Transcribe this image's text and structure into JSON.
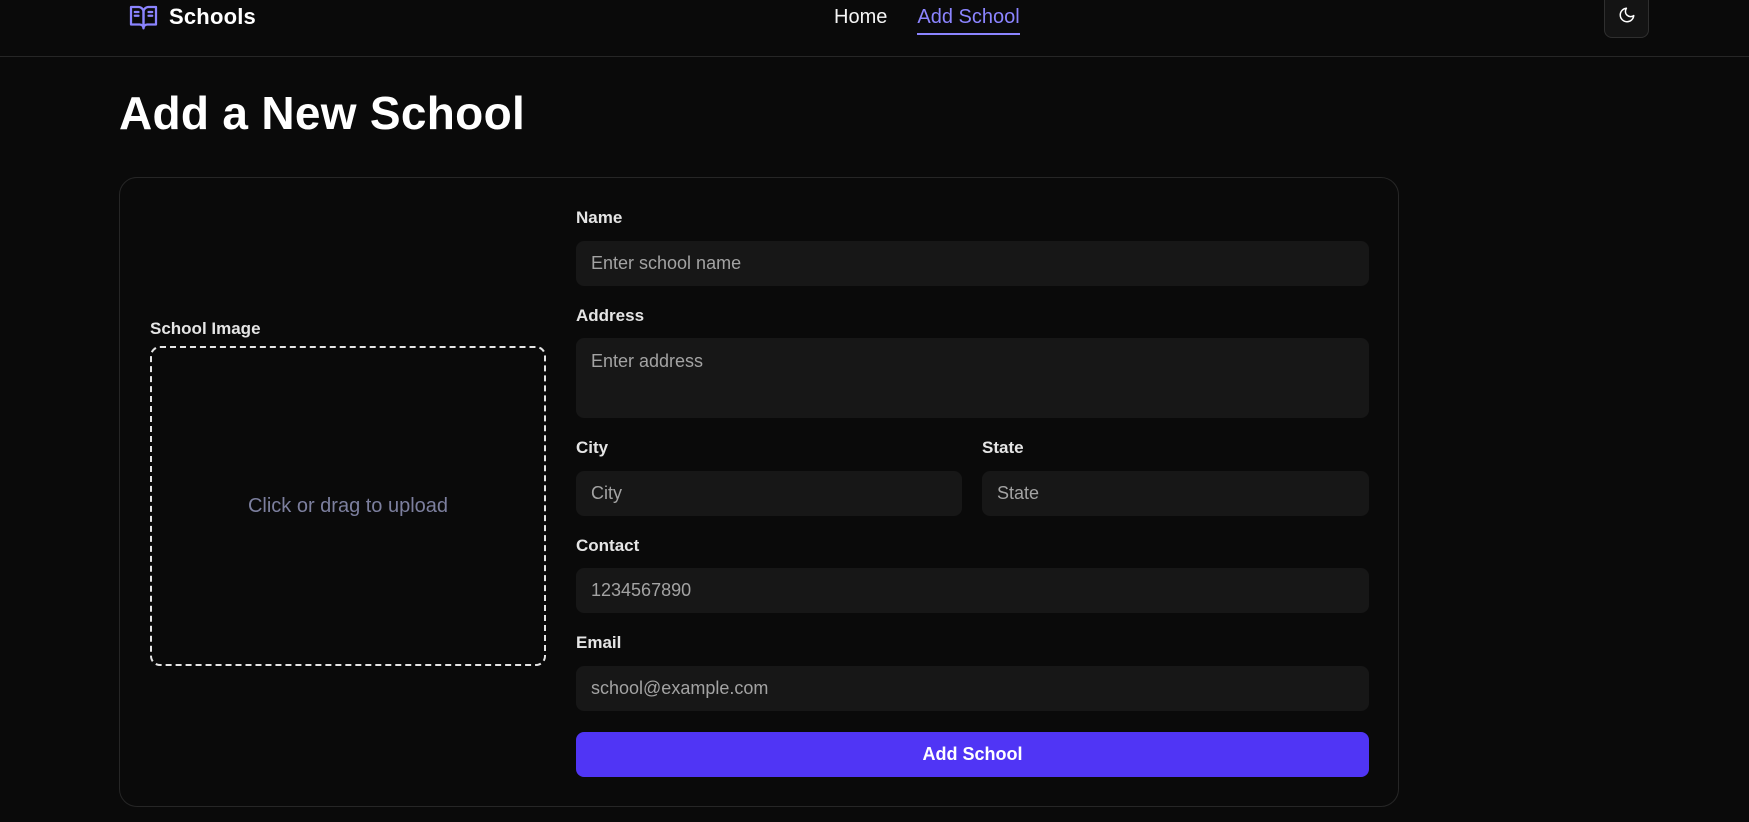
{
  "header": {
    "brand": "Schools",
    "brand_icon": "open-book-icon",
    "nav": [
      {
        "label": "Home",
        "active": false
      },
      {
        "label": "Add School",
        "active": true
      }
    ],
    "theme_toggle_icon": "moon-icon"
  },
  "page": {
    "title": "Add a New School"
  },
  "form": {
    "image": {
      "label": "School Image",
      "prompt": "Click or drag to upload"
    },
    "name": {
      "label": "Name",
      "placeholder": "Enter school name"
    },
    "address": {
      "label": "Address",
      "placeholder": "Enter address"
    },
    "city": {
      "label": "City",
      "placeholder": "City"
    },
    "state": {
      "label": "State",
      "placeholder": "State"
    },
    "contact": {
      "label": "Contact",
      "placeholder": "1234567890"
    },
    "email": {
      "label": "Email",
      "placeholder": "school@example.com"
    },
    "submit_label": "Add School"
  },
  "colors": {
    "background": "#0a0a0a",
    "accent": "#8b84ff",
    "button": "#5035f5",
    "input_bg": "#171717"
  }
}
